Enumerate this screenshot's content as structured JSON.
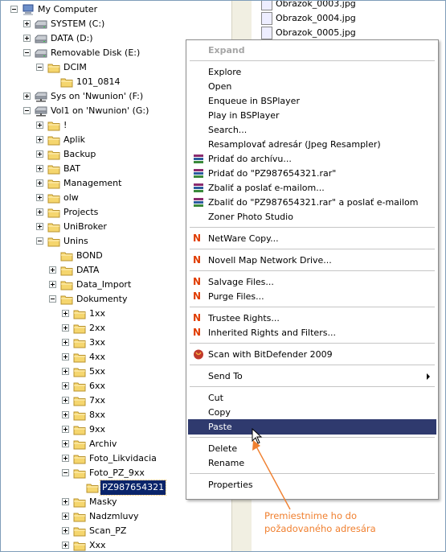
{
  "tree": [
    {
      "label": "My Computer",
      "icon": "computer-icon",
      "exp": "minus"
    },
    {
      "label": "SYSTEM (C:)",
      "icon": "drive-icon",
      "exp": "plus"
    },
    {
      "label": "DATA (D:)",
      "icon": "drive-icon",
      "exp": "plus"
    },
    {
      "label": "Removable Disk (E:)",
      "icon": "drive-icon",
      "exp": "minus"
    },
    {
      "label": "DCIM",
      "icon": "folder-icon",
      "exp": "minus"
    },
    {
      "label": "101_0814",
      "icon": "folder-icon",
      "exp": ""
    },
    {
      "label": "Sys on 'Nwunion' (F:)",
      "icon": "network-drive-icon",
      "exp": "plus"
    },
    {
      "label": "Vol1 on 'Nwunion' (G:)",
      "icon": "network-drive-icon",
      "exp": "minus"
    },
    {
      "label": "!",
      "icon": "folder-icon",
      "exp": "plus"
    },
    {
      "label": "Aplik",
      "icon": "folder-icon",
      "exp": "plus"
    },
    {
      "label": "Backup",
      "icon": "folder-icon",
      "exp": "plus"
    },
    {
      "label": "BAT",
      "icon": "folder-icon",
      "exp": "plus"
    },
    {
      "label": "Management",
      "icon": "folder-icon",
      "exp": "plus"
    },
    {
      "label": "olw",
      "icon": "folder-icon",
      "exp": "plus"
    },
    {
      "label": "Projects",
      "icon": "folder-icon",
      "exp": "plus"
    },
    {
      "label": "UniBroker",
      "icon": "folder-icon",
      "exp": "plus"
    },
    {
      "label": "Unins",
      "icon": "folder-icon",
      "exp": "minus"
    },
    {
      "label": "BOND",
      "icon": "folder-icon",
      "exp": ""
    },
    {
      "label": "DATA",
      "icon": "folder-icon",
      "exp": "plus"
    },
    {
      "label": "Data_Import",
      "icon": "folder-icon",
      "exp": "plus"
    },
    {
      "label": "Dokumenty",
      "icon": "folder-icon",
      "exp": "minus"
    },
    {
      "label": "1xx",
      "icon": "folder-icon",
      "exp": "plus"
    },
    {
      "label": "2xx",
      "icon": "folder-icon",
      "exp": "plus"
    },
    {
      "label": "3xx",
      "icon": "folder-icon",
      "exp": "plus"
    },
    {
      "label": "4xx",
      "icon": "folder-icon",
      "exp": "plus"
    },
    {
      "label": "5xx",
      "icon": "folder-icon",
      "exp": "plus"
    },
    {
      "label": "6xx",
      "icon": "folder-icon",
      "exp": "plus"
    },
    {
      "label": "7xx",
      "icon": "folder-icon",
      "exp": "plus"
    },
    {
      "label": "8xx",
      "icon": "folder-icon",
      "exp": "plus"
    },
    {
      "label": "9xx",
      "icon": "folder-icon",
      "exp": "plus"
    },
    {
      "label": "Archiv",
      "icon": "folder-icon",
      "exp": "plus"
    },
    {
      "label": "Foto_Likvidacia",
      "icon": "folder-icon",
      "exp": "plus"
    },
    {
      "label": "Foto_PZ_9xx",
      "icon": "folder-icon",
      "exp": "minus"
    },
    {
      "label": "PZ987654321",
      "icon": "folder-icon",
      "exp": "",
      "selected": true
    },
    {
      "label": "Masky",
      "icon": "folder-icon",
      "exp": "plus"
    },
    {
      "label": "Nadzmluvy",
      "icon": "folder-icon",
      "exp": "plus"
    },
    {
      "label": "Scan_PZ",
      "icon": "folder-icon",
      "exp": "plus"
    },
    {
      "label": "Xxx",
      "icon": "folder-icon",
      "exp": "plus"
    }
  ],
  "files": [
    "Obrazok_0003.jpg",
    "Obrazok_0004.jpg",
    "Obrazok_0005.jpg"
  ],
  "menu": [
    {
      "label": "Expand",
      "disabled": true
    },
    {
      "sep": true
    },
    {
      "label": "Explore"
    },
    {
      "label": "Open"
    },
    {
      "label": "Enqueue in BSPlayer"
    },
    {
      "label": "Play in BSPlayer"
    },
    {
      "label": "Search..."
    },
    {
      "label": "Resamplovať adresár (Jpeg Resampler)"
    },
    {
      "label": "Pridať do archívu...",
      "icon": "winrar-icon"
    },
    {
      "label": "Pridať do \"PZ987654321.rar\"",
      "icon": "winrar-icon"
    },
    {
      "label": "Zbaliť a poslať e-mailom...",
      "icon": "winrar-icon"
    },
    {
      "label": "Zbaliť do \"PZ987654321.rar\" a poslať e-mailom",
      "icon": "winrar-icon"
    },
    {
      "label": "Zoner Photo Studio"
    },
    {
      "sep": true
    },
    {
      "label": "NetWare Copy...",
      "icon": "netware-icon"
    },
    {
      "sep": true
    },
    {
      "label": "Novell Map Network Drive...",
      "icon": "netware-icon"
    },
    {
      "sep": true
    },
    {
      "label": "Salvage Files...",
      "icon": "netware-icon"
    },
    {
      "label": "Purge Files...",
      "icon": "netware-icon"
    },
    {
      "sep": true
    },
    {
      "label": "Trustee Rights...",
      "icon": "netware-icon"
    },
    {
      "label": "Inherited Rights and Filters...",
      "icon": "netware-icon"
    },
    {
      "sep": true
    },
    {
      "label": "Scan with BitDefender 2009",
      "icon": "bitdefender-icon"
    },
    {
      "sep": true
    },
    {
      "label": "Send To",
      "submenu": true
    },
    {
      "sep": true
    },
    {
      "label": "Cut"
    },
    {
      "label": "Copy"
    },
    {
      "label": "Paste",
      "highlighted": true
    },
    {
      "sep": true
    },
    {
      "label": "Delete"
    },
    {
      "label": "Rename"
    },
    {
      "sep": true
    },
    {
      "label": "Properties"
    }
  ],
  "annotation": {
    "line1": "Premiestnime ho do",
    "line2": "požadovaného adresára",
    "color": "#f08030"
  },
  "colors": {
    "selection": "#0a246a",
    "menu_highlight": "#2f3a6e",
    "folder": "#f5d66e"
  }
}
